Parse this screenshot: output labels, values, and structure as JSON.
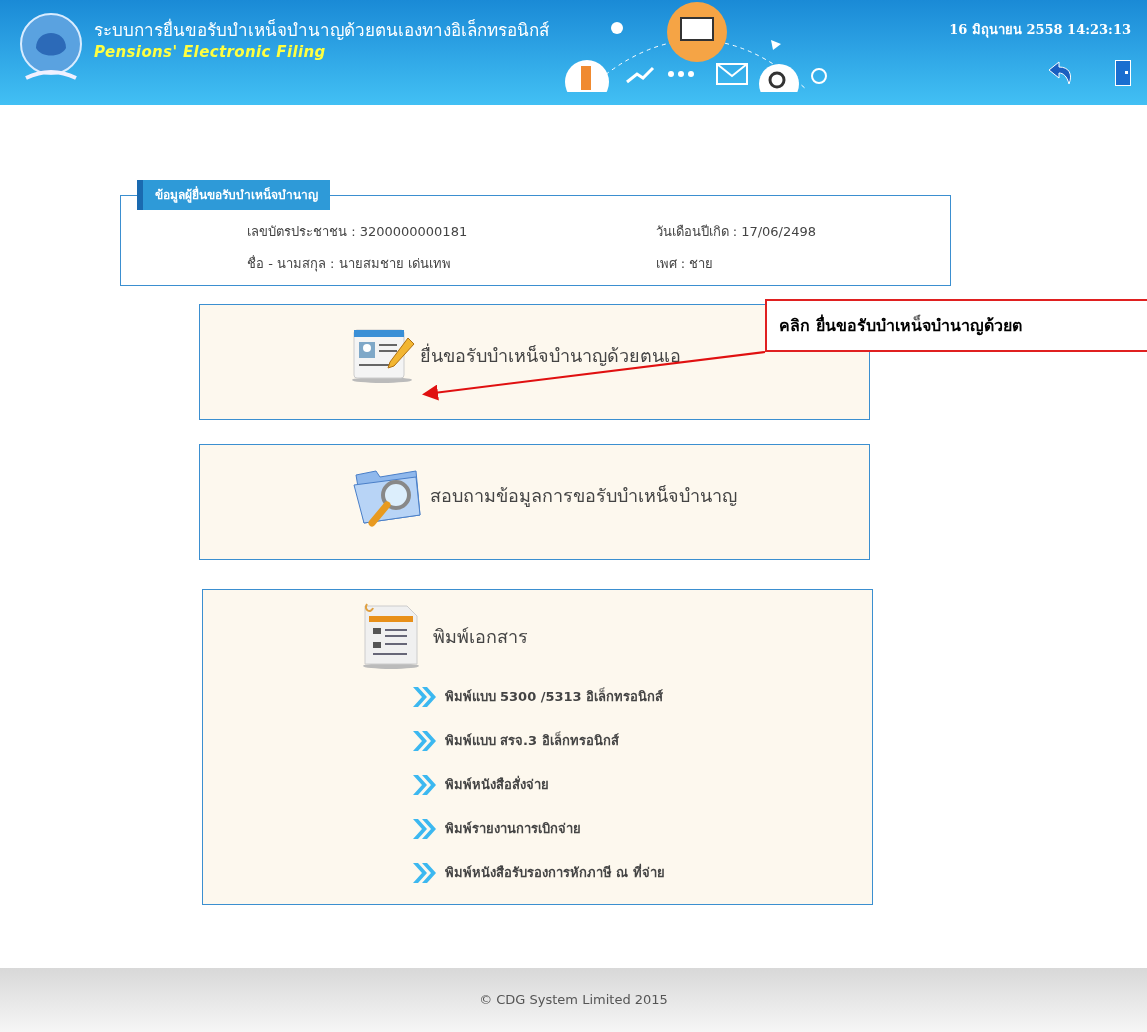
{
  "header": {
    "title": "ระบบการยื่นขอรับบำเหน็จบำนาญด้วยตนเองทางอิเล็กทรอนิกส์",
    "subtitle": "Pensions' Electronic Filing",
    "datetime": "16 มิถุนายน 2558 14:23:13"
  },
  "applicant": {
    "legend": "ข้อมูลผู้ยื่นขอรับบำเหน็จบำนาญ",
    "fields": [
      "เลขบัตรประชาชน : 3200000000181",
      "วันเดือนปีเกิด : 17/06/2498",
      "ชื่อ - นามสกุล : นายสมชาย เด่นเทพ",
      "เพศ : ชาย"
    ]
  },
  "menu_cards": [
    {
      "kind": "form",
      "label": "ยื่นขอรับบำเหน็จบำนาญด้วยตนเอ"
    },
    {
      "kind": "search",
      "label": "สอบถามข้อมูลการขอรับบำเหน็จบำนาญ"
    }
  ],
  "print_card": {
    "title": "พิมพ์เอกสาร",
    "links": [
      "พิมพ์แบบ 5300 /5313 อิเล็กทรอนิกส์",
      "พิมพ์แบบ สรจ.3 อิเล็กทรอนิกส์",
      "พิมพ์หนังสือสั่งจ่าย",
      "พิมพ์รายงานการเบิกจ่าย",
      "พิมพ์หนังสือรับรองการหักภาษี ณ ที่จ่าย"
    ]
  },
  "callout": {
    "text": "คลิก ยื่นขอรับบำเหน็จบำนาญด้วยต"
  },
  "footer": {
    "copyright": "© CDG System Limited 2015"
  }
}
